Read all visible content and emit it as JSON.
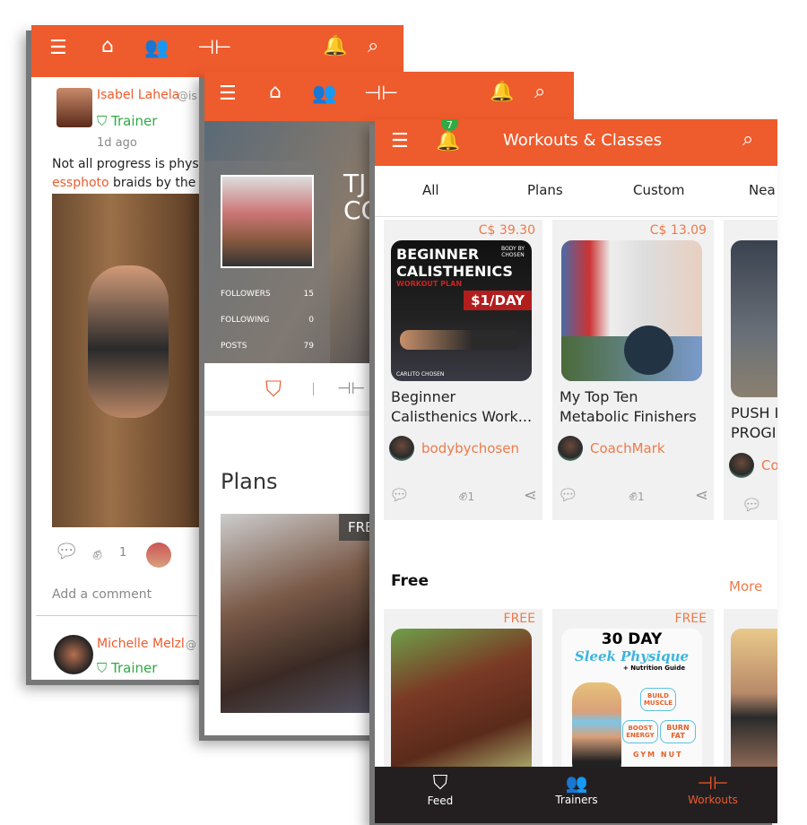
{
  "colors": {
    "brand": "#ee5b2c",
    "trainer": "#2faa44",
    "nav_bg": "#231f20"
  },
  "phone_feed": {
    "header_icons": [
      "profile-list-icon",
      "home-icon",
      "group-icon",
      "dumbbell-icon",
      "bell-icon",
      "search-icon"
    ],
    "posts": [
      {
        "name": "Isabel Lahela",
        "handle": "@is",
        "role": "Trainer",
        "time": "1d ago",
        "text_prefix": "Not all progress is physi",
        "text_link": "essphoto",
        "text_suffix": " braids by the",
        "likes": "1"
      },
      {
        "name": "Michelle Melzl",
        "handle": "@",
        "role": "Trainer"
      }
    ],
    "add_comment": "Add a comment"
  },
  "phone_profile": {
    "name_partial": "TJ T",
    "name_partial2": "CO",
    "stats": [
      {
        "label": "FOLLOWERS",
        "value": "15"
      },
      {
        "label": "FOLLOWING",
        "value": "0"
      },
      {
        "label": "POSTS",
        "value": "79"
      }
    ],
    "section_title": "Plans",
    "plan_badge": "FREE"
  },
  "phone_workouts": {
    "title": "Workouts & Classes",
    "notif_count": "7",
    "tabs": [
      "All",
      "Plans",
      "Custom",
      "Nea"
    ],
    "plans": [
      {
        "price": "C$ 39.30",
        "title1": "Beginner",
        "title2": "Calisthenics Work...",
        "author": "bodybychosen",
        "likes": "1",
        "img_text": [
          "BEGINNER",
          "CALISTHENICS",
          "WORKOUT PLAN",
          "$1/DAY",
          "BODY BY CHOSEN",
          "CARLITO CHOSEN"
        ]
      },
      {
        "price": "C$ 13.09",
        "title1": "My Top Ten",
        "title2": "Metabolic Finishers",
        "author": "CoachMark",
        "likes": "1"
      },
      {
        "price": "",
        "title1": "PUSH I",
        "title2": "PROGI",
        "author": "Coa"
      }
    ],
    "free_title": "Free",
    "more": "More",
    "free_items": [
      {
        "badge": "FREE"
      },
      {
        "badge": "FREE",
        "img_text": [
          "30 DAY",
          "Sleek Physique",
          "+ Nutrition Guide",
          "BUILD MUSCLE",
          "BOOST ENERGY",
          "BURN FAT",
          "GYM NUT"
        ]
      }
    ],
    "nav": [
      {
        "label": "Feed",
        "icon": "kettlebell-icon"
      },
      {
        "label": "Trainers",
        "icon": "group-icon"
      },
      {
        "label": "Workouts",
        "icon": "dumbbell-icon",
        "active": true
      }
    ]
  }
}
